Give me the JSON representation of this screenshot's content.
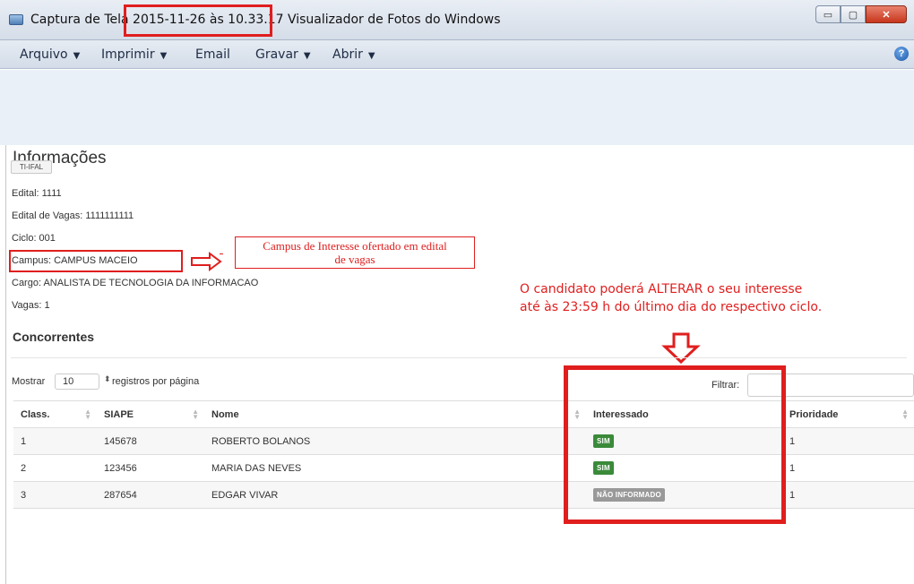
{
  "window": {
    "title_prefix": "Captura de Tela ",
    "title_timestamp": "2015-11-26 às 10.33.17",
    "title_suffix": " Visualizador de Fotos do Windows",
    "btn_min": "▭",
    "btn_max": "▢",
    "btn_close": "✕"
  },
  "menu": {
    "items": [
      {
        "label": "Arquivo",
        "caret": true
      },
      {
        "label": "Imprimir",
        "caret": true
      },
      {
        "label": "Email",
        "caret": false
      },
      {
        "label": "Gravar",
        "caret": true
      },
      {
        "label": "Abrir",
        "caret": true
      }
    ],
    "help": "?"
  },
  "info": {
    "title": "Informações",
    "badge": "TI-IFAL",
    "fields": [
      "Edital: 1111",
      "Edital de Vagas: 1111111111",
      "Ciclo: 001",
      "Campus: CAMPUS MACEIO",
      "Cargo: ANALISTA DE TECNOLOGIA DA INFORMACAO",
      "Vagas: 1"
    ]
  },
  "annotations": {
    "campus_note_line1": "Campus de Interesse ofertado em edital",
    "campus_note_line2": "de vagas",
    "alter_note_line1": "O candidato poderá ALTERAR o seu interesse",
    "alter_note_line2": "até às 23:59 h do último dia do respectivo ciclo.",
    "accent_color": "#e01e1e"
  },
  "concorrentes": {
    "title": "Concorrentes",
    "show_label": "Mostrar",
    "page_size": "10",
    "page_size_suffix": "registros por página",
    "filter_label": "Filtrar:",
    "filter_value": "",
    "columns": [
      "Class.",
      "SIAPE",
      "Nome",
      "Interessado",
      "Prioridade"
    ],
    "rows": [
      {
        "class": "1",
        "siape": "145678",
        "nome": "ROBERTO BOLANOS",
        "interessado": "SIM",
        "status": "yes",
        "prioridade": "1"
      },
      {
        "class": "2",
        "siape": "123456",
        "nome": "MARIA DAS NEVES",
        "interessado": "SIM",
        "status": "yes",
        "prioridade": "1"
      },
      {
        "class": "3",
        "siape": "287654",
        "nome": "EDGAR VIVAR",
        "interessado": "NÃO INFORMADO",
        "status": "unknown",
        "prioridade": "1"
      }
    ],
    "badge_colors": {
      "yes": "#3a8a3a",
      "unknown": "#999999"
    }
  }
}
